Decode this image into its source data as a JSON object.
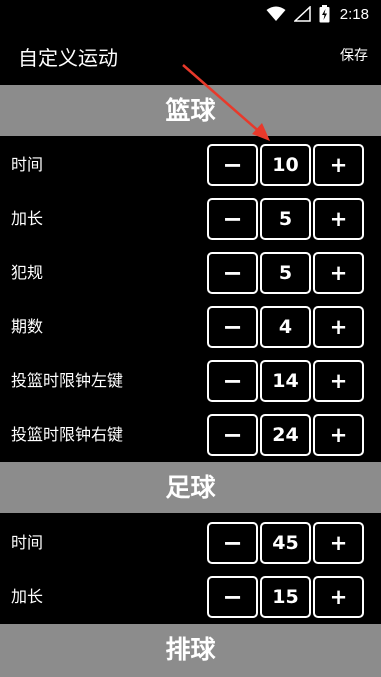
{
  "status": {
    "time": "2:18"
  },
  "app": {
    "title": "自定义运动",
    "save_label": "保存"
  },
  "sections": [
    {
      "title": "篮球",
      "rows": [
        {
          "label": "时间",
          "value": "10"
        },
        {
          "label": "加长",
          "value": "5"
        },
        {
          "label": "犯规",
          "value": "5"
        },
        {
          "label": "期数",
          "value": "4"
        },
        {
          "label": "投篮时限钟左键",
          "value": "14"
        },
        {
          "label": "投篮时限钟右键",
          "value": "24"
        }
      ]
    },
    {
      "title": "足球",
      "rows": [
        {
          "label": "时间",
          "value": "45"
        },
        {
          "label": "加长",
          "value": "15"
        }
      ]
    },
    {
      "title": "排球"
    }
  ],
  "controls": {
    "minus": "−",
    "plus": "+"
  },
  "colors": {
    "background": "#000000",
    "section_header": "#8c8c8c",
    "arrow": "#e8392b"
  }
}
